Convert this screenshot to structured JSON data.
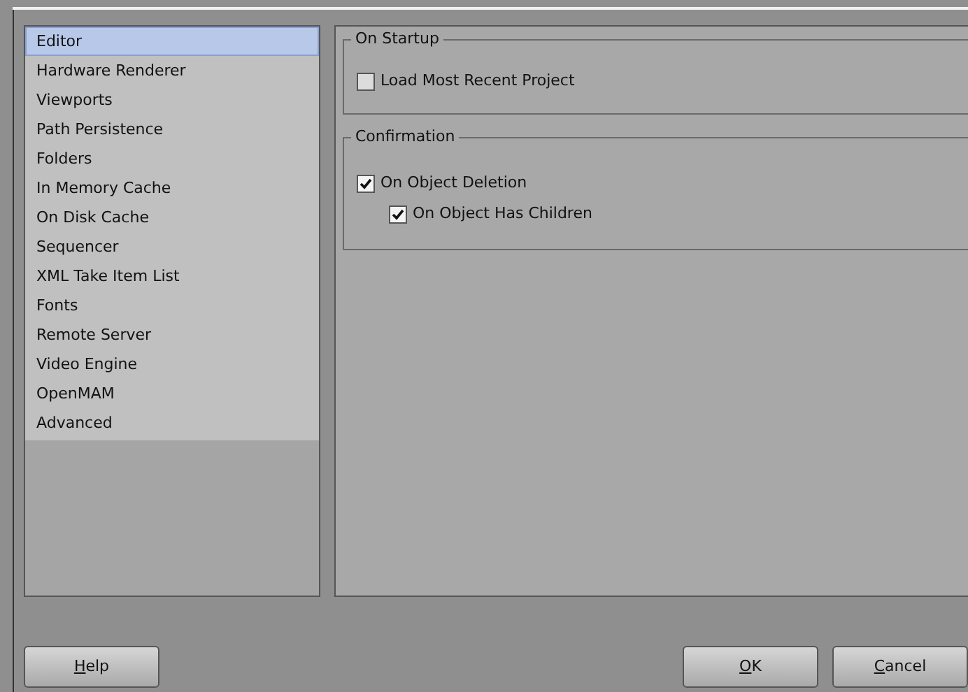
{
  "sidebar": {
    "items": [
      {
        "label": "Editor",
        "selected": true
      },
      {
        "label": "Hardware Renderer",
        "selected": false
      },
      {
        "label": "Viewports",
        "selected": false
      },
      {
        "label": "Path Persistence",
        "selected": false
      },
      {
        "label": "Folders",
        "selected": false
      },
      {
        "label": "In Memory Cache",
        "selected": false
      },
      {
        "label": "On Disk Cache",
        "selected": false
      },
      {
        "label": "Sequencer",
        "selected": false
      },
      {
        "label": "XML Take Item List",
        "selected": false
      },
      {
        "label": "Fonts",
        "selected": false
      },
      {
        "label": "Remote Server",
        "selected": false
      },
      {
        "label": "Video Engine",
        "selected": false
      },
      {
        "label": "OpenMAM",
        "selected": false
      },
      {
        "label": "Advanced",
        "selected": false
      }
    ]
  },
  "groups": [
    {
      "title": "On Startup",
      "options": [
        {
          "label": "Load Most Recent Project",
          "checked": false
        }
      ]
    },
    {
      "title": "Confirmation",
      "options": [
        {
          "label": "On Object Deletion",
          "checked": true,
          "children": [
            {
              "label": "On Object Has Children",
              "checked": true
            }
          ]
        }
      ]
    }
  ],
  "buttons": [
    {
      "label": "Help",
      "access_key_underlined": true,
      "kind": "left"
    },
    {
      "label": "OK",
      "access_key_underlined": true,
      "kind": "right"
    },
    {
      "label": "Cancel",
      "access_key_underlined": true,
      "kind": "right"
    }
  ]
}
